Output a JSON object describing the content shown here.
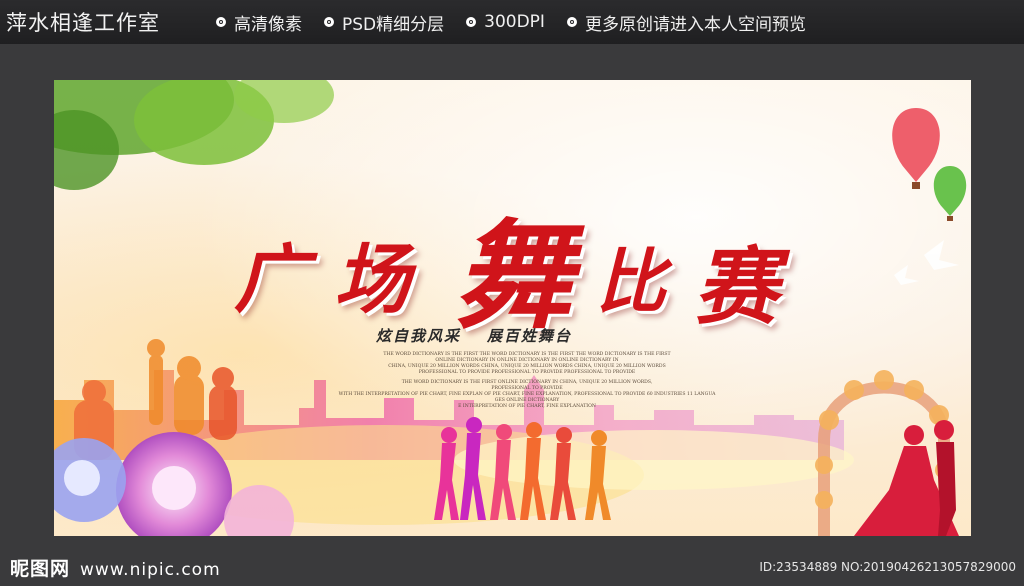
{
  "header": {
    "studio": "萍水相逢工作室",
    "features": [
      "高清像素",
      "PSD精细分层",
      "300DPI",
      "更多原创请进入本人空间预览"
    ]
  },
  "poster": {
    "title_chars": [
      "广",
      "场",
      "舞",
      "比",
      "赛"
    ],
    "slogans": [
      "炫自我风采",
      "展百姓舞台"
    ],
    "fine_print": [
      "THE WORD DICTIONARY IS THE FIRST   THE WORD DICTIONARY IS THE FIRST   THE WORD DICTIONARY IS THE FIRST",
      "ONLINE DICTIONARY IN   ONLINE DICTIONARY IN   ONLINE DICTIONARY IN",
      "CHINA, UNIQUE 20 MILLION WORDS   CHINA, UNIQUE 20 MILLION WORDS   CHINA, UNIQUE 20 MILLION WORDS",
      "PROFESSIONAL TO PROVIDE   PROFESSIONAL TO PROVIDE   PROFESSIONAL TO PROVIDE",
      "THE WORD DICTIONARY IS THE FIRST ONLINE DICTIONARY IN CHINA, UNIQUE 20 MILLION WORDS,",
      "PROFESSIONAL TO PROVIDE",
      "WITH THE INTERPRETATION OF PIE CHART, FINE EXPLAN OF PIE CHART, FINE EXPLANATION, PROFESSIONAL TO PROVIDE 60 INDUSTRIES 11 LANGUA",
      "GES ONLINE DICTIONARY",
      "E INTERPRETATION OF PIE CHART, FINE EXPLANATION"
    ]
  },
  "footer": {
    "site_name": "昵图网",
    "site_url": "www.nipic.com",
    "image_id": "ID:23534889 NO:20190426213057829000"
  },
  "colors": {
    "title_red": "#d0141a",
    "bar_dark": "#232325",
    "page_bg": "#3a3a3c"
  }
}
